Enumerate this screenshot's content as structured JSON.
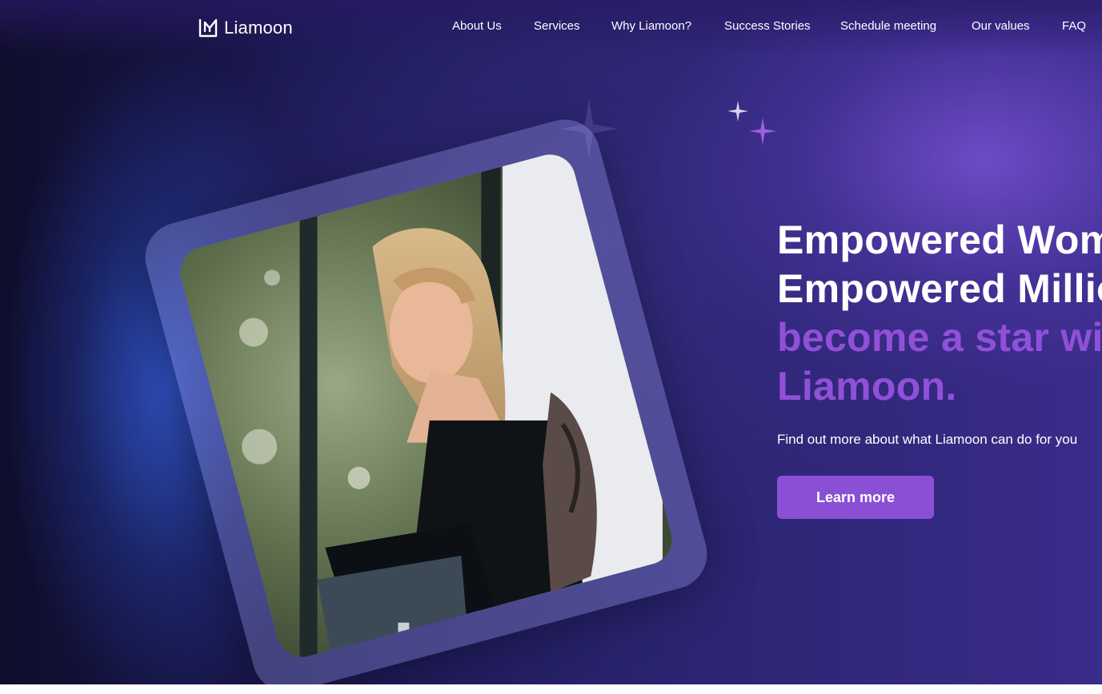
{
  "header": {
    "logo_text": "Liamoon",
    "nav": [
      {
        "label": "About Us"
      },
      {
        "label": "Services"
      },
      {
        "label": "Why Liamoon?"
      },
      {
        "label": "Success Stories"
      },
      {
        "label": "Schedule meeting"
      },
      {
        "label": "Our values"
      },
      {
        "label": "FAQ"
      }
    ]
  },
  "hero": {
    "line1": "Empowered Wom",
    "line2": "Empowered Millio",
    "line3": "become a star wi",
    "line4": "Liamoon.",
    "subtitle": "Find out more about what Liamoon can do for you",
    "cta_label": "Learn more"
  },
  "colors": {
    "accent": "#9150d8",
    "button": "#8b4fd6",
    "text": "#ffffff",
    "background_dark": "#1c1a55"
  },
  "icons": [
    "logo-mark-icon",
    "sparkle-icon"
  ]
}
